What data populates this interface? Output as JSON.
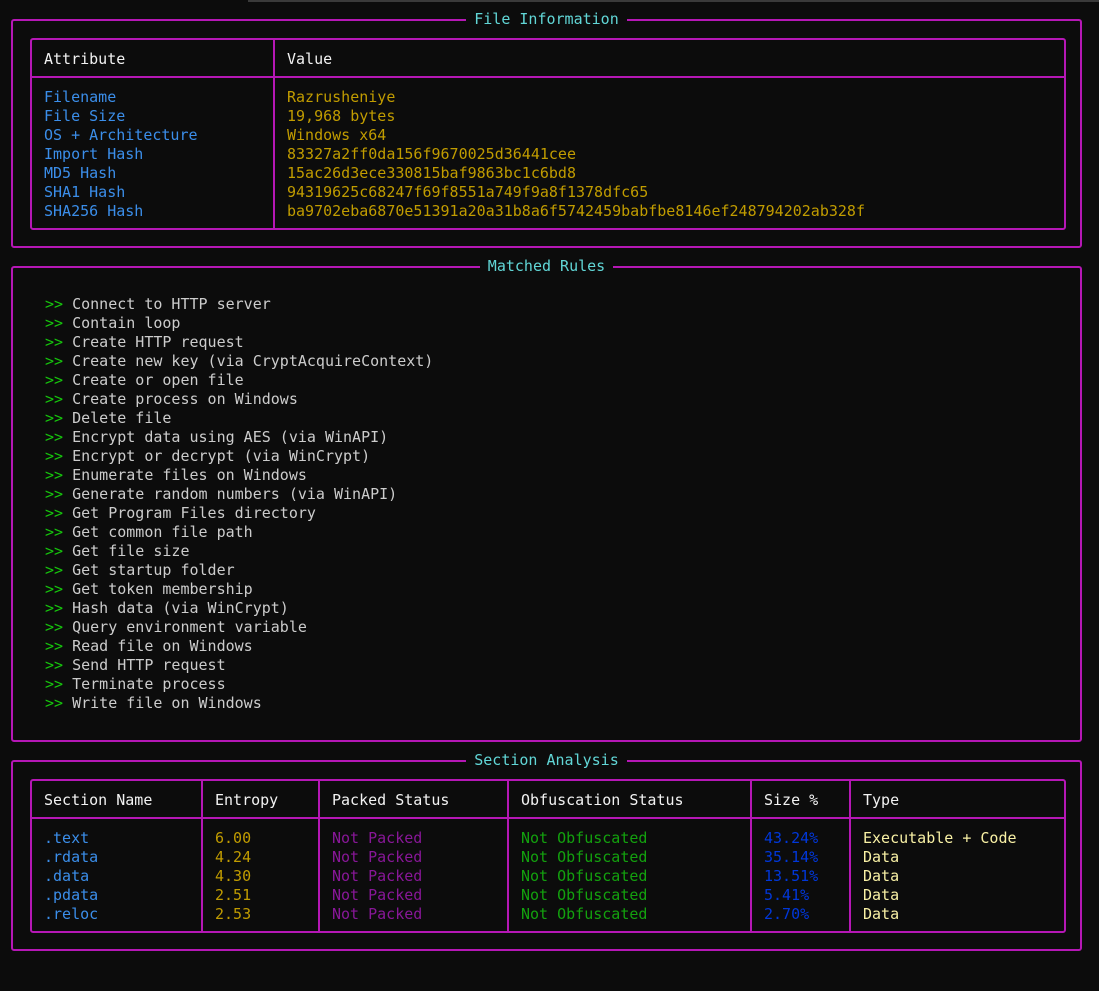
{
  "file_information": {
    "title": "File Information",
    "headers": [
      "Attribute",
      "Value"
    ],
    "rows": [
      {
        "attribute": "Filename",
        "value": "Razrusheniye"
      },
      {
        "attribute": "File Size",
        "value": "19,968 bytes"
      },
      {
        "attribute": "OS + Architecture",
        "value": "Windows x64"
      },
      {
        "attribute": "Import Hash",
        "value": "83327a2ff0da156f9670025d36441cee"
      },
      {
        "attribute": "MD5 Hash",
        "value": "15ac26d3ece330815baf9863bc1c6bd8"
      },
      {
        "attribute": "SHA1 Hash",
        "value": "94319625c68247f69f8551a749f9a8f1378dfc65"
      },
      {
        "attribute": "SHA256 Hash",
        "value": "ba9702eba6870e51391a20a31b8a6f5742459babfbe8146ef248794202ab328f"
      }
    ]
  },
  "matched_rules": {
    "title": "Matched Rules",
    "marker": ">>",
    "items": [
      "Connect to HTTP server",
      "Contain loop",
      "Create HTTP request",
      "Create new key (via CryptAcquireContext)",
      "Create or open file",
      "Create process on Windows",
      "Delete file",
      "Encrypt data using AES (via WinAPI)",
      "Encrypt or decrypt (via WinCrypt)",
      "Enumerate files on Windows",
      "Generate random numbers (via WinAPI)",
      "Get Program Files directory",
      "Get common file path",
      "Get file size",
      "Get startup folder",
      "Get token membership",
      "Hash data (via WinCrypt)",
      "Query environment variable",
      "Read file on Windows",
      "Send HTTP request",
      "Terminate process",
      "Write file on Windows"
    ]
  },
  "section_analysis": {
    "title": "Section Analysis",
    "headers": [
      "Section Name",
      "Entropy",
      "Packed Status",
      "Obfuscation Status",
      "Size %",
      "Type"
    ],
    "rows": [
      {
        "name": ".text",
        "entropy": "6.00",
        "packed": "Not Packed",
        "obfuscation": "Not Obfuscated",
        "size": "43.24%",
        "type": "Executable + Code"
      },
      {
        "name": ".rdata",
        "entropy": "4.24",
        "packed": "Not Packed",
        "obfuscation": "Not Obfuscated",
        "size": "35.14%",
        "type": "Data"
      },
      {
        "name": ".data",
        "entropy": "4.30",
        "packed": "Not Packed",
        "obfuscation": "Not Obfuscated",
        "size": "13.51%",
        "type": "Data"
      },
      {
        "name": ".pdata",
        "entropy": "2.51",
        "packed": "Not Packed",
        "obfuscation": "Not Obfuscated",
        "size": "5.41%",
        "type": "Data"
      },
      {
        "name": ".reloc",
        "entropy": "2.53",
        "packed": "Not Packed",
        "obfuscation": "Not Obfuscated",
        "size": "2.70%",
        "type": "Data"
      }
    ]
  },
  "colors": {
    "border": "#b517b5",
    "title": "#61d6d6",
    "attribute": "#3b8eea",
    "value": "#c19c00",
    "arrow": "#16c60c",
    "packed": "#881798",
    "obfuscation": "#13a10e",
    "size": "#0037da",
    "type": "#f9f1a5"
  }
}
